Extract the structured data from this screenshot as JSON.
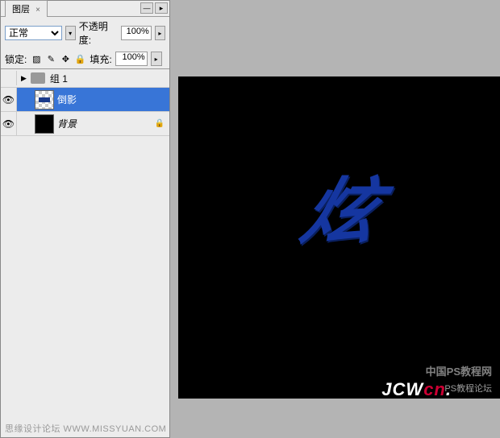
{
  "panel": {
    "tab_label": "图层",
    "blend_label": "",
    "blend_mode": "正常",
    "opacity_label": "不透明度:",
    "opacity_value": "100%",
    "lock_label": "锁定:",
    "fill_label": "填充:",
    "fill_value": "100%",
    "group_label": "组 1",
    "layers": [
      {
        "name": "倒影",
        "type": "checker",
        "selected": true
      },
      {
        "name": "背景",
        "type": "black",
        "selected": false,
        "locked": true
      }
    ]
  },
  "footer": {
    "text": "思缘设计论坛 WWW.MISSYUAN.COM"
  },
  "canvas": {
    "main_char": "炫",
    "watermark_top": "中国PS教程网",
    "watermark_sub": "PS教程论坛",
    "watermark_logo_a": "JCW",
    "watermark_logo_b": "cn",
    "watermark_logo_dot": "."
  }
}
